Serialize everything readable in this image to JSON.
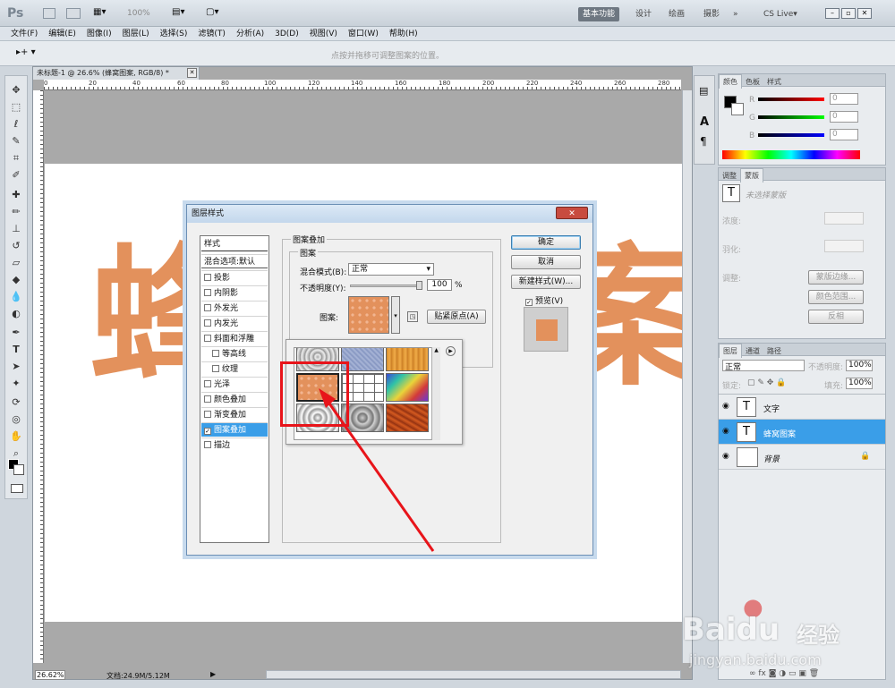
{
  "app": {
    "logo": "Ps",
    "zoom": "100%",
    "workspaces": [
      "基本功能",
      "设计",
      "绘画",
      "摄影"
    ],
    "more": "»",
    "cslive": "CS Live▾"
  },
  "menu": [
    "文件(F)",
    "编辑(E)",
    "图像(I)",
    "图层(L)",
    "选择(S)",
    "滤镜(T)",
    "分析(A)",
    "3D(D)",
    "视图(V)",
    "窗口(W)",
    "帮助(H)"
  ],
  "options": {
    "hint": "点按并拖移可调整图案的位置。",
    "tool_glyph": "▸+ ▾"
  },
  "document": {
    "tab": "未标题-1 @ 26.6% (蜂窝图案, RGB/8) *",
    "ruler": [
      "0",
      "20",
      "40",
      "60",
      "80",
      "100",
      "120",
      "140",
      "160",
      "180",
      "200",
      "220",
      "240",
      "260",
      "280"
    ],
    "text_left": "蜂",
    "text_right": "案"
  },
  "status": {
    "zoom": "26.62%",
    "doc": "文档:24.9M/5.12M"
  },
  "dialog": {
    "title": "图层样式",
    "left_header": "样式",
    "blend_default": "混合选项:默认",
    "effects": [
      {
        "label": "投影",
        "checked": false
      },
      {
        "label": "内阴影",
        "checked": false
      },
      {
        "label": "外发光",
        "checked": false
      },
      {
        "label": "内发光",
        "checked": false
      },
      {
        "label": "斜面和浮雕",
        "checked": false
      },
      {
        "label": "等高线",
        "checked": false,
        "sub": true
      },
      {
        "label": "纹理",
        "checked": false,
        "sub": true
      },
      {
        "label": "光泽",
        "checked": false
      },
      {
        "label": "颜色叠加",
        "checked": false
      },
      {
        "label": "渐变叠加",
        "checked": false
      },
      {
        "label": "图案叠加",
        "checked": true,
        "selected": true
      },
      {
        "label": "描边",
        "checked": false
      }
    ],
    "section_title": "图案叠加",
    "group_title": "图案",
    "blend_label": "混合模式(B):",
    "blend_value": "正常",
    "opacity_label": "不透明度(Y):",
    "opacity_value": "100",
    "opacity_unit": "%",
    "pattern_label": "图案:",
    "snap_button": "贴紧原点(A)",
    "ok": "确定",
    "cancel": "取消",
    "new_style": "新建样式(W)...",
    "preview": "预览(V)",
    "close": "✕"
  },
  "color_panel": {
    "tabs": [
      "颜色",
      "色板",
      "样式"
    ],
    "channels": [
      "R",
      "G",
      "B"
    ],
    "values": [
      "0",
      "0",
      "0"
    ]
  },
  "mask_panel": {
    "tabs": [
      "调整",
      "蒙版"
    ],
    "no_selection": "未选择蒙版",
    "density": "浓度:",
    "feather": "羽化:",
    "refine": "调整:",
    "buttons": [
      "蒙版边缘...",
      "颜色范围...",
      "反相"
    ]
  },
  "layers_panel": {
    "tabs": [
      "图层",
      "通道",
      "路径"
    ],
    "mode": "正常",
    "opacity_label": "不透明度:",
    "opacity": "100%",
    "lock_label": "锁定:",
    "fill_label": "填充:",
    "fill": "100%",
    "layers": [
      {
        "name": "文字",
        "type": "T",
        "selected": false
      },
      {
        "name": "蜂窝图案",
        "type": "T",
        "selected": true
      },
      {
        "name": "背景",
        "type": "bg",
        "selected": false
      }
    ]
  },
  "watermark": {
    "brand": "Baidu",
    "sub": "经验",
    "url": "jingyan.baidu.com"
  },
  "colors": {
    "accent": "#3a9ee8",
    "orange": "#e3915c",
    "arrow": "#e8141a"
  }
}
